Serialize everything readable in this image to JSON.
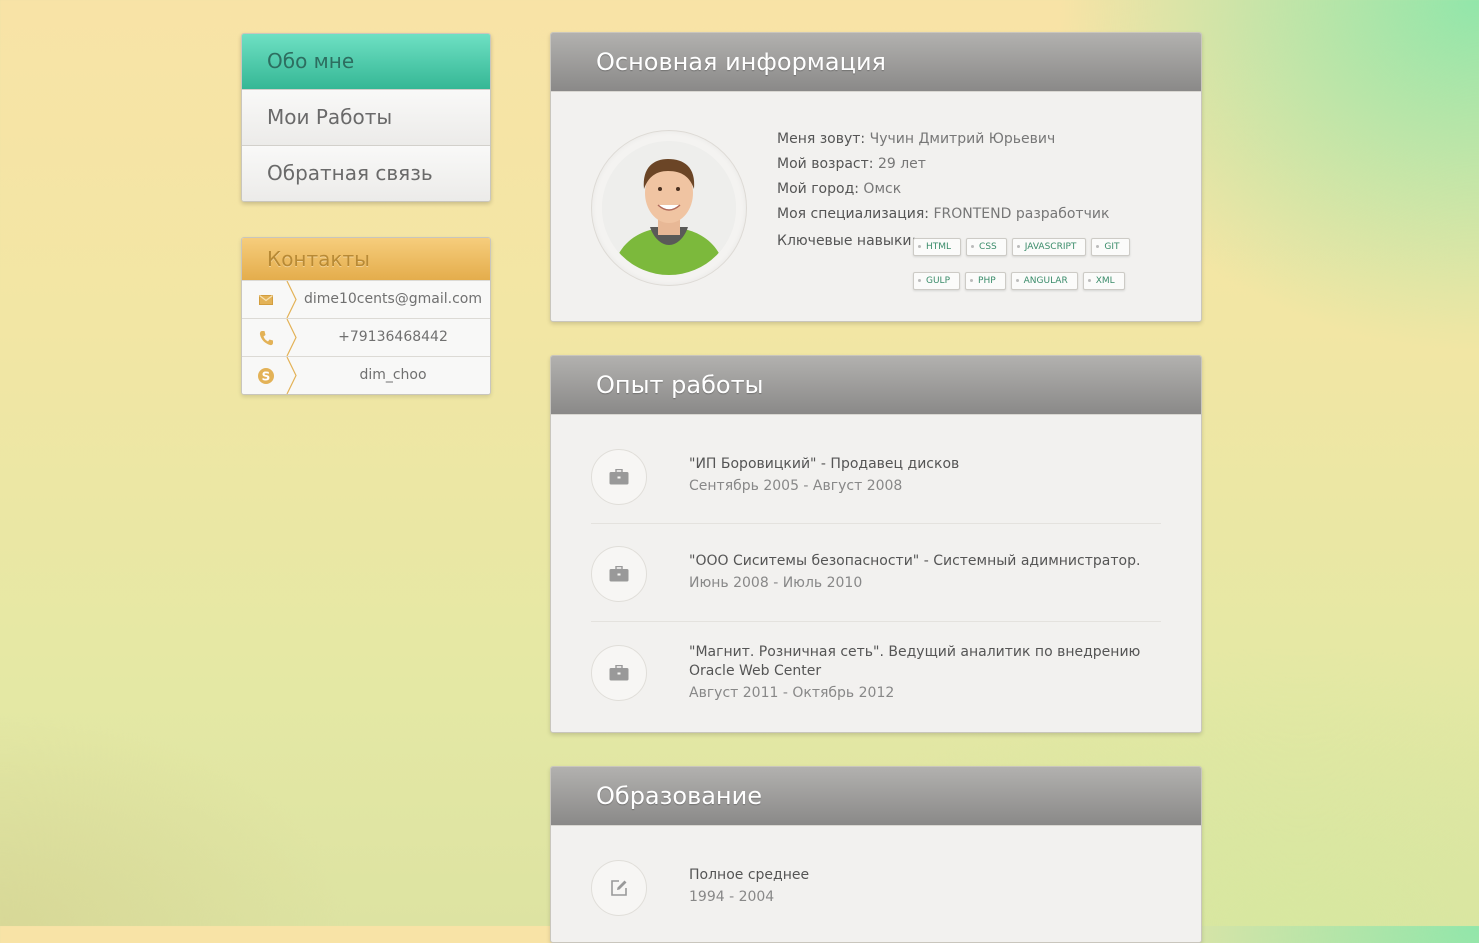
{
  "menu": {
    "items": [
      {
        "label": "Обо мне"
      },
      {
        "label": "Мои Работы"
      },
      {
        "label": "Обратная связь"
      }
    ]
  },
  "contacts": {
    "title": "Контакты",
    "email": "dime10cents@gmail.com",
    "phone": "+79136468442",
    "skype": "dim_choo"
  },
  "info": {
    "title": "Основная информация",
    "name_label": "Меня зовут:",
    "name_value": "Чучин Дмитрий Юрьевич",
    "age_label": "Мой возраст:",
    "age_value": "29 лет",
    "city_label": "Мой город:",
    "city_value": "Омск",
    "spec_label": "Моя специализация:",
    "spec_value": "FRONTEND разработчик",
    "skills_label": "Ключевые навыки:",
    "skills": [
      "HTML",
      "CSS",
      "JAVASCRIPT",
      "GIT",
      "GULP",
      "PHP",
      "ANGULAR",
      "XML"
    ]
  },
  "work": {
    "title": "Опыт работы",
    "jobs": [
      {
        "title": "\"ИП Боровицкий\" - Продавец дисков",
        "date": "Сентябрь 2005 - Август 2008"
      },
      {
        "title": "\"ООО Сиситемы безопасности\" - Системный адимнистратор.",
        "date": "Июнь 2008 - Июль 2010"
      },
      {
        "title": "\"Магнит. Розничная сеть\". Ведущий аналитик по внедрению Oracle Web Center",
        "date": "Август 2011 - Октябрь 2012"
      }
    ]
  },
  "education": {
    "title": "Образование",
    "items": [
      {
        "title": "Полное среднее",
        "date": "1994 - 2004"
      }
    ]
  },
  "colors": {
    "accent": "#35b795",
    "contacts_header": "#e4ad4c",
    "panel_header": "#8a8988"
  }
}
